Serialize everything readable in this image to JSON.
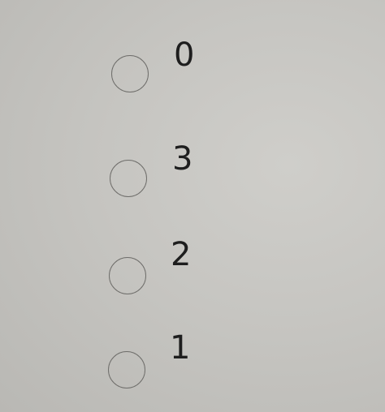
{
  "question": {
    "options": [
      {
        "label": "0",
        "selected": false
      },
      {
        "label": "3",
        "selected": false
      },
      {
        "label": "2",
        "selected": false
      },
      {
        "label": "1",
        "selected": false
      }
    ]
  }
}
